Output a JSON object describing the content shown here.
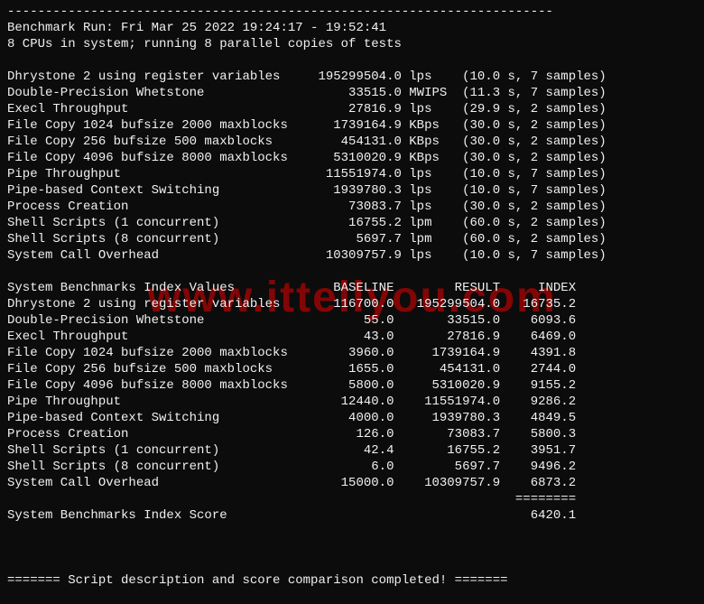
{
  "watermark": "www.ittellyou.com",
  "header": {
    "dashline_top": "------------------------------------------------------------------------",
    "run_line": "Benchmark Run: Fri Mar 25 2022 19:24:17 - 19:52:41",
    "cpu_line": "8 CPUs in system; running 8 parallel copies of tests"
  },
  "raw_results": [
    {
      "name": "Dhrystone 2 using register variables",
      "value": "195299504.0",
      "unit": "lps",
      "timing": "(10.0 s, 7 samples)"
    },
    {
      "name": "Double-Precision Whetstone",
      "value": "33515.0",
      "unit": "MWIPS",
      "timing": "(11.3 s, 7 samples)"
    },
    {
      "name": "Execl Throughput",
      "value": "27816.9",
      "unit": "lps",
      "timing": "(29.9 s, 2 samples)"
    },
    {
      "name": "File Copy 1024 bufsize 2000 maxblocks",
      "value": "1739164.9",
      "unit": "KBps",
      "timing": "(30.0 s, 2 samples)"
    },
    {
      "name": "File Copy 256 bufsize 500 maxblocks",
      "value": "454131.0",
      "unit": "KBps",
      "timing": "(30.0 s, 2 samples)"
    },
    {
      "name": "File Copy 4096 bufsize 8000 maxblocks",
      "value": "5310020.9",
      "unit": "KBps",
      "timing": "(30.0 s, 2 samples)"
    },
    {
      "name": "Pipe Throughput",
      "value": "11551974.0",
      "unit": "lps",
      "timing": "(10.0 s, 7 samples)"
    },
    {
      "name": "Pipe-based Context Switching",
      "value": "1939780.3",
      "unit": "lps",
      "timing": "(10.0 s, 7 samples)"
    },
    {
      "name": "Process Creation",
      "value": "73083.7",
      "unit": "lps",
      "timing": "(30.0 s, 2 samples)"
    },
    {
      "name": "Shell Scripts (1 concurrent)",
      "value": "16755.2",
      "unit": "lpm",
      "timing": "(60.0 s, 2 samples)"
    },
    {
      "name": "Shell Scripts (8 concurrent)",
      "value": "5697.7",
      "unit": "lpm",
      "timing": "(60.0 s, 2 samples)"
    },
    {
      "name": "System Call Overhead",
      "value": "10309757.9",
      "unit": "lps",
      "timing": "(10.0 s, 7 samples)"
    }
  ],
  "index_header": {
    "label": "System Benchmarks Index Values",
    "col_baseline": "BASELINE",
    "col_result": "RESULT",
    "col_index": "INDEX"
  },
  "index_results": [
    {
      "name": "Dhrystone 2 using register variables",
      "baseline": "116700.0",
      "result": "195299504.0",
      "index": "16735.2"
    },
    {
      "name": "Double-Precision Whetstone",
      "baseline": "55.0",
      "result": "33515.0",
      "index": "6093.6"
    },
    {
      "name": "Execl Throughput",
      "baseline": "43.0",
      "result": "27816.9",
      "index": "6469.0"
    },
    {
      "name": "File Copy 1024 bufsize 2000 maxblocks",
      "baseline": "3960.0",
      "result": "1739164.9",
      "index": "4391.8"
    },
    {
      "name": "File Copy 256 bufsize 500 maxblocks",
      "baseline": "1655.0",
      "result": "454131.0",
      "index": "2744.0"
    },
    {
      "name": "File Copy 4096 bufsize 8000 maxblocks",
      "baseline": "5800.0",
      "result": "5310020.9",
      "index": "9155.2"
    },
    {
      "name": "Pipe Throughput",
      "baseline": "12440.0",
      "result": "11551974.0",
      "index": "9286.2"
    },
    {
      "name": "Pipe-based Context Switching",
      "baseline": "4000.0",
      "result": "1939780.3",
      "index": "4849.5"
    },
    {
      "name": "Process Creation",
      "baseline": "126.0",
      "result": "73083.7",
      "index": "5800.3"
    },
    {
      "name": "Shell Scripts (1 concurrent)",
      "baseline": "42.4",
      "result": "16755.2",
      "index": "3951.7"
    },
    {
      "name": "Shell Scripts (8 concurrent)",
      "baseline": "6.0",
      "result": "5697.7",
      "index": "9496.2"
    },
    {
      "name": "System Call Overhead",
      "baseline": "15000.0",
      "result": "10309757.9",
      "index": "6873.2"
    }
  ],
  "score": {
    "divider": "                                                                   ========",
    "label": "System Benchmarks Index Score",
    "value": "6420.1"
  },
  "footer": {
    "line": "======= Script description and score comparison completed! ======="
  }
}
